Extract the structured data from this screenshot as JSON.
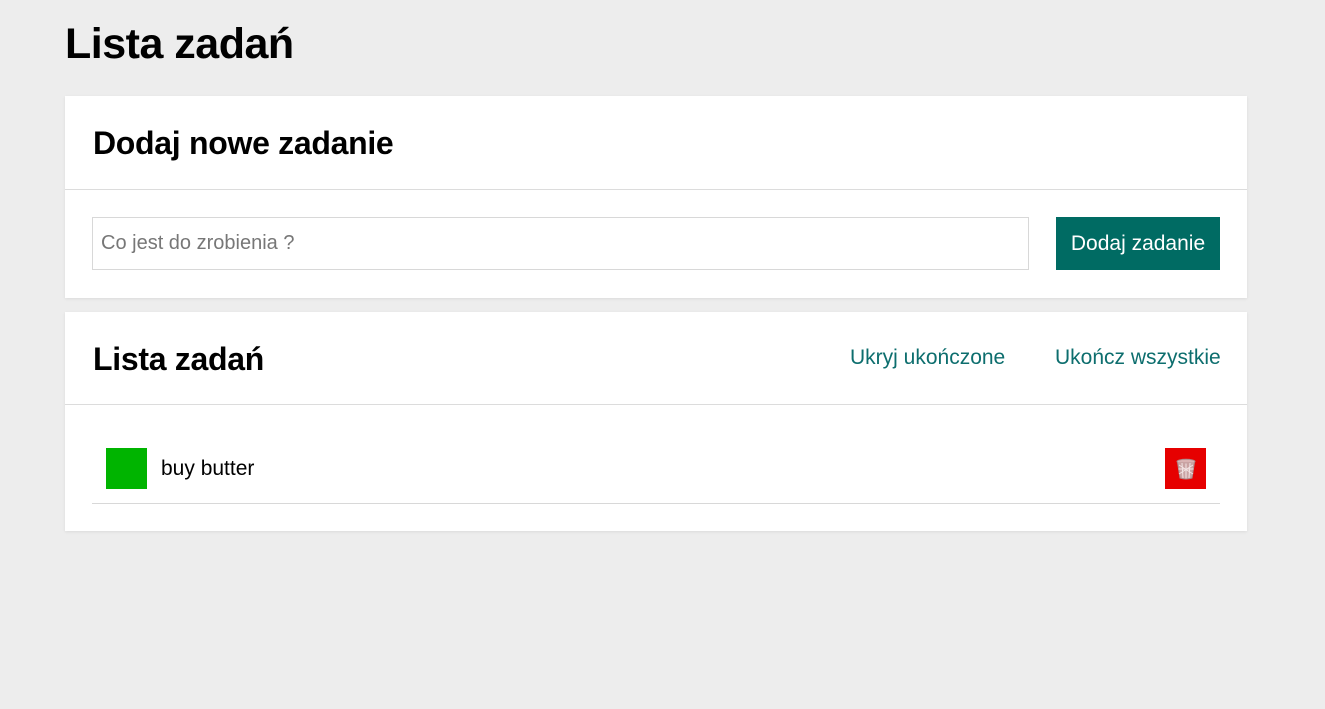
{
  "page": {
    "title": "Lista zadań"
  },
  "add_card": {
    "heading": "Dodaj nowe zadanie",
    "input_placeholder": "Co jest do zrobienia ?",
    "input_value": "",
    "button_label": "Dodaj zadanie"
  },
  "list_card": {
    "heading": "Lista zadań",
    "hide_completed_label": "Ukryj ukończone",
    "complete_all_label": "Ukończ wszystkie",
    "tasks": [
      {
        "label": "buy butter",
        "completed": true,
        "check_icon": "check-square-icon",
        "delete_icon": "trash-bin-icon"
      }
    ]
  },
  "colors": {
    "background": "#ededed",
    "accent": "#006b63",
    "link": "#0d6e6e",
    "done": "#00b400",
    "delete": "#e60000"
  }
}
